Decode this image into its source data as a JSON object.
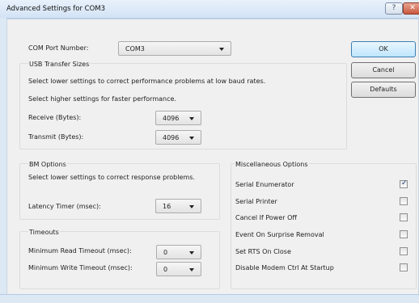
{
  "window": {
    "title": "Advanced Settings for COM3",
    "help_button": "?",
    "close_button": "✕"
  },
  "com_port": {
    "label": "COM Port Number:",
    "value": "COM3"
  },
  "usb": {
    "title": "USB Transfer Sizes",
    "hint1": "Select lower settings to correct performance problems at low baud rates.",
    "hint2": "Select higher settings for faster performance.",
    "receive_label": "Receive (Bytes):",
    "receive_value": "4096",
    "transmit_label": "Transmit (Bytes):",
    "transmit_value": "4096"
  },
  "bm": {
    "title": "BM Options",
    "hint": "Select lower settings to correct response problems.",
    "latency_label": "Latency Timer (msec):",
    "latency_value": "16"
  },
  "timeouts": {
    "title": "Timeouts",
    "read_label": "Minimum Read Timeout (msec):",
    "read_value": "0",
    "write_label": "Minimum Write Timeout (msec):",
    "write_value": "0"
  },
  "misc": {
    "title": "Miscellaneous Options",
    "options": [
      {
        "label": "Serial Enumerator",
        "checked": true
      },
      {
        "label": "Serial Printer",
        "checked": false
      },
      {
        "label": "Cancel If Power Off",
        "checked": false
      },
      {
        "label": "Event On Surprise Removal",
        "checked": false
      },
      {
        "label": "Set RTS On Close",
        "checked": false
      },
      {
        "label": "Disable Modem Ctrl At Startup",
        "checked": false
      }
    ],
    "check_mark": "✓"
  },
  "buttons": {
    "ok": "OK",
    "cancel": "Cancel",
    "defaults": "Defaults"
  }
}
